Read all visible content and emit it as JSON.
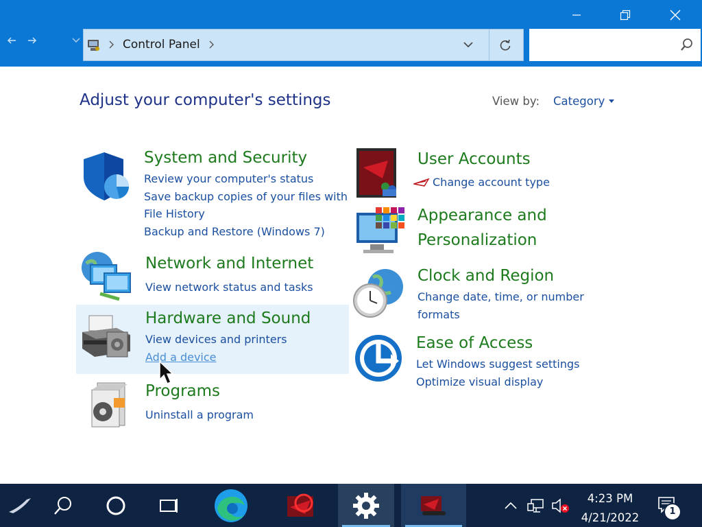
{
  "window": {
    "title_controls": [
      "minimize",
      "restore",
      "close"
    ]
  },
  "address_bar": {
    "path_item": "Control Panel",
    "search_placeholder": ""
  },
  "content": {
    "heading": "Adjust your computer's settings",
    "view_by_label": "View by:",
    "view_by_value": "Category",
    "categories_left": [
      {
        "title": "System and Security",
        "icon": "shield-icon",
        "links": [
          "Review your computer's status",
          "Save backup copies of your files with",
          "File History",
          "Backup and Restore (Windows 7)"
        ]
      },
      {
        "title": "Network and Internet",
        "icon": "network-icon",
        "links": [
          "View network status and tasks"
        ]
      },
      {
        "title": "Hardware and Sound",
        "icon": "printer-icon",
        "links": [
          "View devices and printers",
          "Add a device"
        ]
      },
      {
        "title": "Programs",
        "icon": "programs-icon",
        "links": [
          "Uninstall a program"
        ]
      }
    ],
    "categories_right": [
      {
        "title": "User Accounts",
        "icon": "user-accounts-icon",
        "links": [
          "Change account type"
        ]
      },
      {
        "title_line1": "Appearance and",
        "title_line2": "Personalization",
        "icon": "appearance-icon",
        "links": []
      },
      {
        "title": "Clock and Region",
        "icon": "clock-icon",
        "links": [
          "Change date, time, or number",
          "formats"
        ]
      },
      {
        "title": "Ease of Access",
        "icon": "ease-of-access-icon",
        "links": [
          "Let Windows suggest settings",
          "Optimize visual display"
        ]
      }
    ]
  },
  "taskbar": {
    "time": "4:23 PM",
    "date": "4/21/2022",
    "notification_count": "1"
  },
  "colors": {
    "titlebar": "#0a78d4",
    "taskbar": "#0f2443",
    "category_title": "#1d7a1d",
    "link": "#1b4fa0",
    "heading": "#1e3287",
    "hover_highlight": "#e5f1fb"
  }
}
